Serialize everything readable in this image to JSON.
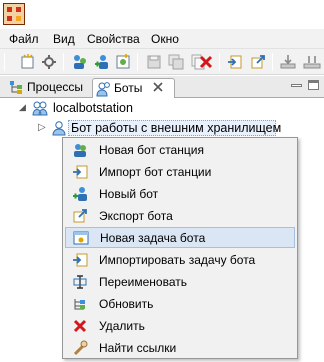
{
  "menubar": {
    "items": [
      "Файл",
      "Вид",
      "Свойства",
      "Окно"
    ]
  },
  "tabs": [
    {
      "label": "Процессы",
      "icon": "process-tree-icon",
      "active": false
    },
    {
      "label": "Боты",
      "icon": "bots-icon",
      "active": true
    }
  ],
  "tree": {
    "root": {
      "label": "localbotstation",
      "icon": "bot-station-icon",
      "expanded": true
    },
    "child": {
      "label": "Бот работы с внешним хранилищем",
      "icon": "bot-icon",
      "selected": true
    }
  },
  "context_menu": {
    "items": [
      {
        "label": "Новая бот станция",
        "icon": "new-bot-station-icon"
      },
      {
        "label": "Импорт бот станции",
        "icon": "import-bot-station-icon"
      },
      {
        "label": "Новый бот",
        "icon": "new-bot-icon"
      },
      {
        "label": "Экспорт бота",
        "icon": "export-bot-icon"
      },
      {
        "label": "Новая задача бота",
        "icon": "new-bot-task-icon",
        "highlighted": true
      },
      {
        "label": "Импортировать задачу бота",
        "icon": "import-bot-task-icon"
      },
      {
        "label": "Переименовать",
        "icon": "rename-icon"
      },
      {
        "label": "Обновить",
        "icon": "refresh-icon"
      },
      {
        "label": "Удалить",
        "icon": "delete-icon"
      },
      {
        "label": "Найти ссылки",
        "icon": "find-references-icon"
      }
    ]
  },
  "colors": {
    "menu_highlight": "#dbe6f4",
    "tree_selection": "#e7f0fb",
    "delete_red": "#d3171c"
  }
}
